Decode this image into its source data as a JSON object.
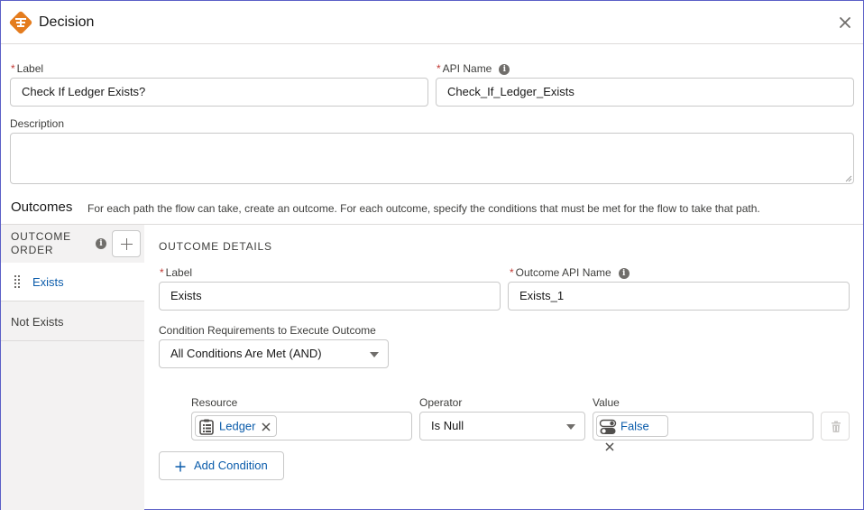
{
  "header": {
    "title": "Decision"
  },
  "form": {
    "label_label": "Label",
    "label_value": "Check If Ledger Exists?",
    "api_name_label": "API Name",
    "api_name_value": "Check_If_Ledger_Exists",
    "description_label": "Description",
    "description_value": ""
  },
  "outcomes": {
    "title": "Outcomes",
    "description": "For each path the flow can take, create an outcome. For each outcome, specify the conditions that must be met for the flow to take that path.",
    "order_header_line1": "OUTCOME",
    "order_header_line2": "ORDER",
    "items": [
      {
        "label": "Exists"
      },
      {
        "label": "Not Exists"
      }
    ]
  },
  "details": {
    "header": "OUTCOME DETAILS",
    "label_label": "Label",
    "label_value": "Exists",
    "api_name_label": "Outcome API Name",
    "api_name_value": "Exists_1",
    "condition_req_label": "Condition Requirements to Execute Outcome",
    "condition_req_value": "All Conditions Are Met (AND)",
    "condition": {
      "resource_label": "Resource",
      "resource_value": "Ledger",
      "operator_label": "Operator",
      "operator_value": "Is Null",
      "value_label": "Value",
      "value_value": "False"
    },
    "add_condition_label": "Add Condition"
  },
  "colors": {
    "accent": "#0b5cab",
    "decision_icon": "#e47c1e",
    "required": "#c23934"
  },
  "icons": {
    "decision": "decision-icon",
    "close": "close-icon",
    "info": "info-icon",
    "add": "add-icon",
    "drag": "drag-handle-icon",
    "record": "record-collection-icon",
    "toggle": "boolean-toggle-icon",
    "remove": "remove-icon",
    "trash": "trash-icon"
  }
}
